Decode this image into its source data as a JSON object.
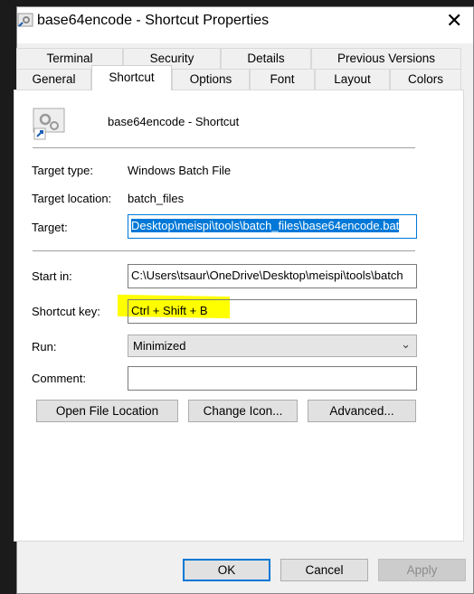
{
  "window": {
    "title": "base64encode - Shortcut Properties",
    "icon": "shortcut-gear-icon"
  },
  "tabs_row1": [
    "Terminal",
    "Security",
    "Details",
    "Previous Versions"
  ],
  "tabs_row2": [
    "General",
    "Shortcut",
    "Options",
    "Font",
    "Layout",
    "Colors"
  ],
  "selected_tab": "Shortcut",
  "shortcut": {
    "name": "base64encode - Shortcut",
    "target_type_label": "Target type:",
    "target_type": "Windows Batch File",
    "target_location_label": "Target location:",
    "target_location": "batch_files",
    "target_label": "Target:",
    "target": "Desktop\\meispi\\tools\\batch_files\\base64encode.bat",
    "start_in_label": "Start in:",
    "start_in": "C:\\Users\\tsaur\\OneDrive\\Desktop\\meispi\\tools\\batch",
    "shortcut_key_label": "Shortcut key:",
    "shortcut_key": "Ctrl + Shift + B",
    "run_label": "Run:",
    "run": "Minimized",
    "comment_label": "Comment:",
    "comment": "",
    "open_file_location": "Open File Location",
    "change_icon": "Change Icon...",
    "advanced": "Advanced..."
  },
  "footer": {
    "ok": "OK",
    "cancel": "Cancel",
    "apply": "Apply"
  },
  "colors": {
    "selection": "#0078d7",
    "highlight": "#ffff00",
    "focus": "#0078d7"
  }
}
